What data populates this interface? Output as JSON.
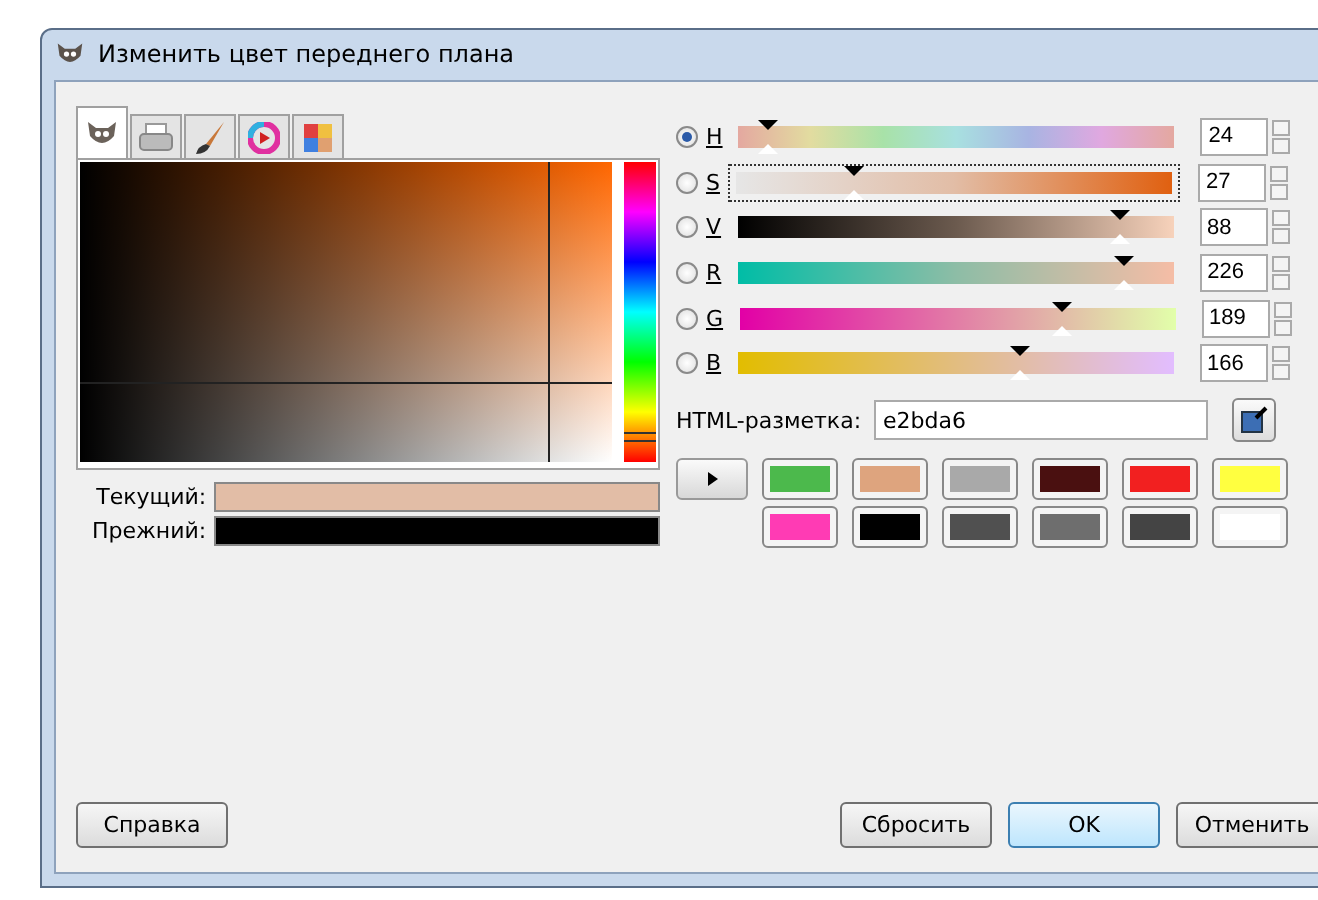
{
  "window": {
    "title": "Изменить цвет переднего плана"
  },
  "tabs": [
    {
      "kind": "mascot",
      "selected": true
    },
    {
      "kind": "printer",
      "selected": false
    },
    {
      "kind": "brush",
      "selected": false
    },
    {
      "kind": "wheel",
      "selected": false
    },
    {
      "kind": "palette",
      "selected": false
    }
  ],
  "preview": [
    {
      "label": "Текущий:",
      "color": "#e2bda6"
    },
    {
      "label": "Прежний:",
      "color": "#000000"
    }
  ],
  "channels": [
    {
      "kind": "hue",
      "label": "H",
      "selected": true,
      "focused": false,
      "level": 0.067,
      "value": "24"
    },
    {
      "kind": "saturation",
      "label": "S",
      "selected": false,
      "focused": true,
      "level": 0.27,
      "value": "27"
    },
    {
      "kind": "value",
      "label": "V",
      "selected": false,
      "focused": false,
      "level": 0.88,
      "value": "88"
    },
    {
      "kind": "red",
      "label": "R",
      "selected": false,
      "focused": false,
      "level": 0.886,
      "value": "226"
    },
    {
      "kind": "green",
      "label": "G",
      "selected": false,
      "focused": false,
      "level": 0.741,
      "value": "189"
    },
    {
      "kind": "blue",
      "label": "B",
      "selected": false,
      "focused": false,
      "level": 0.651,
      "value": "166"
    }
  ],
  "html": {
    "label": "HTML-разметка:",
    "value": "e2bda6"
  },
  "swatches": [
    {
      "color": "#4cb94c"
    },
    {
      "color": "#dea47e"
    },
    {
      "color": "#a9a9a9"
    },
    {
      "color": "#4a1010"
    },
    {
      "color": "#f22020"
    },
    {
      "color": "#ffff40"
    },
    {
      "color": "#ff3bb4"
    },
    {
      "color": "#000000"
    },
    {
      "color": "#505050"
    },
    {
      "color": "#6e6e6e"
    },
    {
      "color": "#444444"
    },
    {
      "color": "#ffffff"
    }
  ],
  "buttons": [
    {
      "label": "Справка",
      "kind": "left",
      "default": false
    },
    {
      "label": "Сбросить",
      "kind": "right",
      "default": false
    },
    {
      "label": "OK",
      "kind": "right",
      "default": true
    },
    {
      "label": "Отменить",
      "kind": "right",
      "default": false
    }
  ]
}
